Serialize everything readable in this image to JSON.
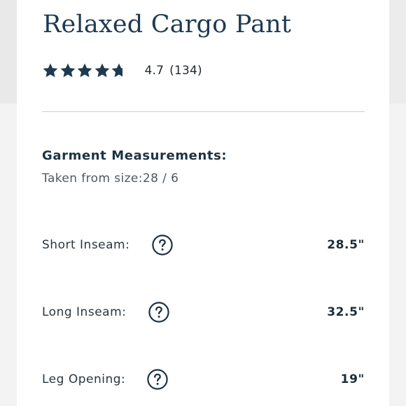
{
  "product": {
    "title": "Relaxed Cargo Pant",
    "rating": {
      "value": 4.7,
      "display_value": "4.7",
      "count_label": "(134)",
      "max_stars": 5,
      "star_color": "#1e3a50"
    }
  },
  "measurements": {
    "heading": "Garment Measurements:",
    "subheading": "Taken from size:28 / 6",
    "help_icon": "question-circle-icon",
    "rows": [
      {
        "label": "Short Inseam:",
        "value": "28.5\""
      },
      {
        "label": "Long Inseam:",
        "value": "32.5\""
      },
      {
        "label": "Leg Opening:",
        "value": "19\""
      }
    ]
  }
}
